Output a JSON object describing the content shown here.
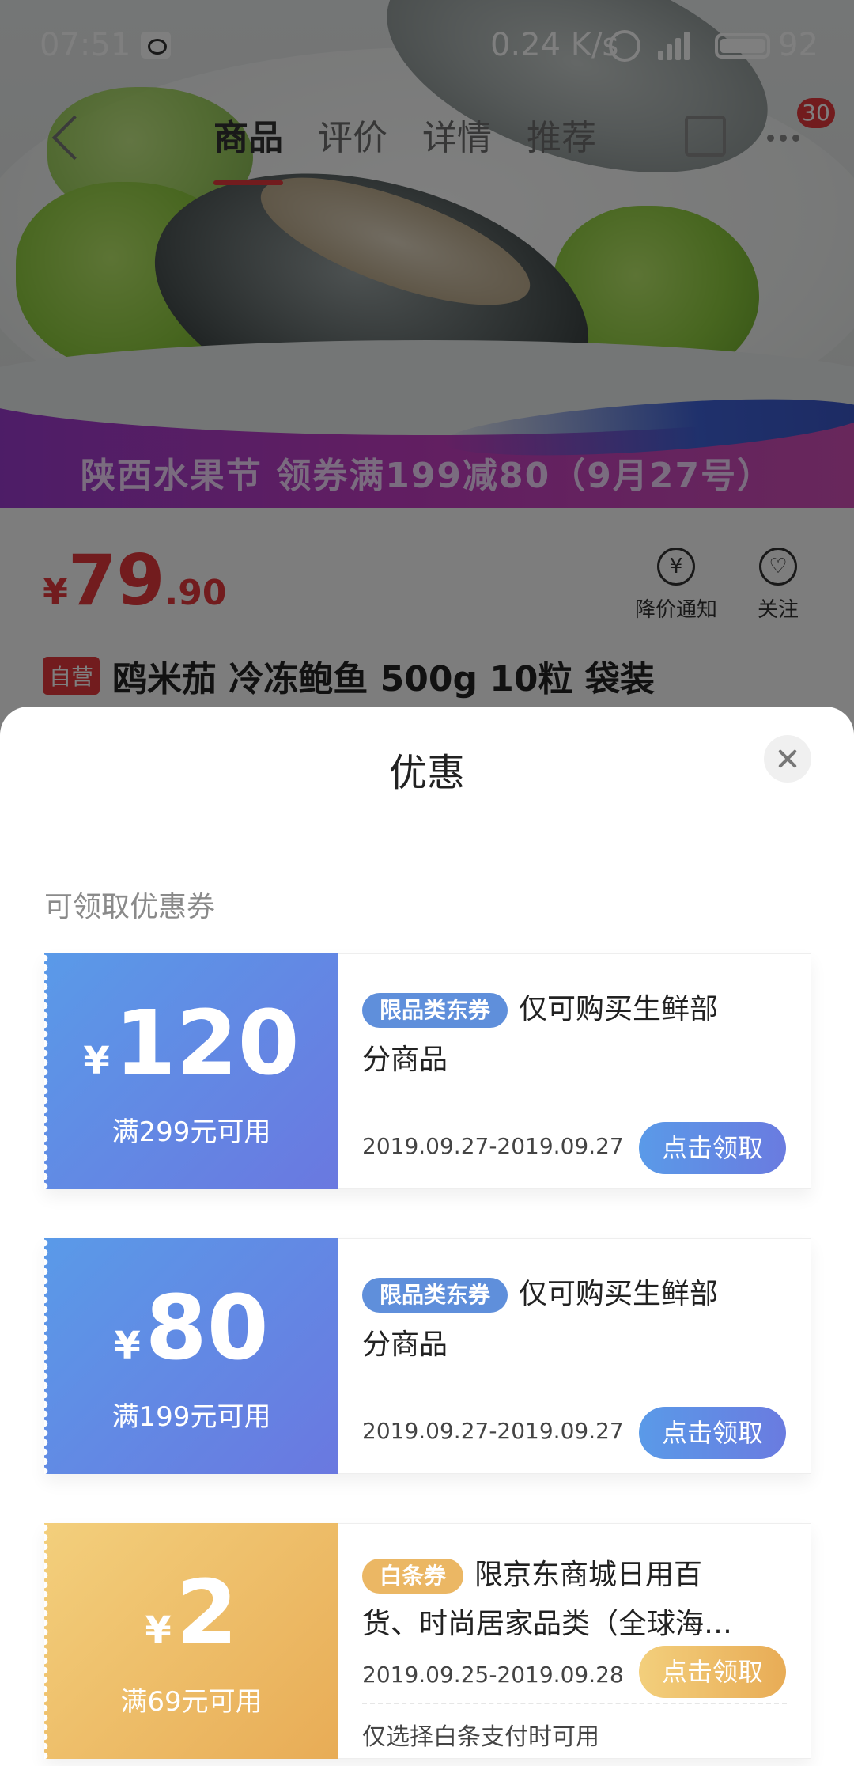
{
  "status_bar": {
    "time": "07:51",
    "net_speed": "0.24 K/s",
    "battery": "92"
  },
  "nav": {
    "tabs": [
      {
        "label": "商品"
      },
      {
        "label": "评价"
      },
      {
        "label": "详情"
      },
      {
        "label": "推荐"
      }
    ],
    "cart_badge": "30"
  },
  "banner": {
    "text": "陕西水果节  领券满199减80（9月27号）"
  },
  "product": {
    "currency": "¥",
    "price_int": "79",
    "price_dec": ".90",
    "price_notify_label": "降价通知",
    "follow_label": "关注",
    "self_operated_tag": "自营",
    "title": "鸥米茄 冷冻鲍鱼 500g 10粒 袋装"
  },
  "sheet": {
    "title": "优惠",
    "section_label": "可领取优惠券",
    "coupons": [
      {
        "currency": "¥",
        "amount": "120",
        "condition": "满299元可用",
        "tag": "限品类东券",
        "desc_line1": "仅可购买生鲜部",
        "desc_line2": "分商品",
        "date": "2019.09.27-2019.09.27",
        "button": "点击领取"
      },
      {
        "currency": "¥",
        "amount": "80",
        "condition": "满199元可用",
        "tag": "限品类东券",
        "desc_line1": "仅可购买生鲜部",
        "desc_line2": "分商品",
        "date": "2019.09.27-2019.09.27",
        "button": "点击领取"
      },
      {
        "currency": "¥",
        "amount": "2",
        "condition": "满69元可用",
        "tag": "白条券",
        "desc_line1": "限京东商城日用百",
        "desc_line2": "货、时尚居家品类（全球海囤...",
        "date": "2019.09.25-2019.09.28",
        "button": "点击领取",
        "note": "仅选择白条支付时可用"
      }
    ]
  },
  "colors": {
    "accent_red": "#e4393c",
    "coupon_blue": "#5a9ae8",
    "coupon_gold": "#e8ac56"
  }
}
